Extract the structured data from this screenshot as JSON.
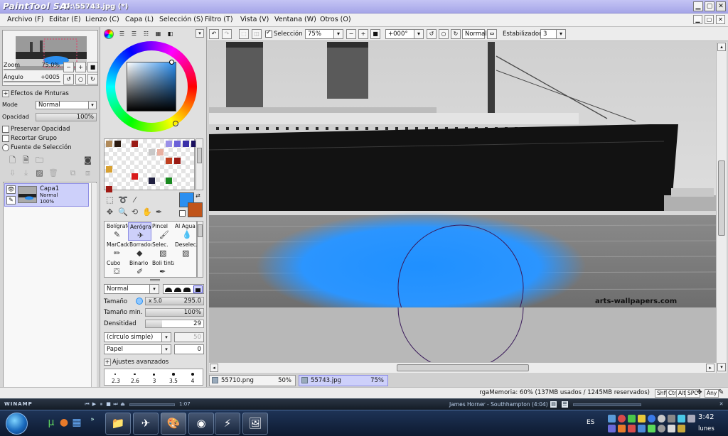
{
  "app": {
    "logo": "PaintTool SAI",
    "document_title": "D:\\55743.jpg (*)"
  },
  "menu": {
    "items": [
      "Archivo (F)",
      "Editar (E)",
      "Lienzo (C)",
      "Capa (L)",
      "Selección (S)",
      "Filtro (T)",
      "Vista (V)",
      "Ventana (W)",
      "Otros (O)"
    ]
  },
  "navigator": {
    "zoom_label": "Zoom",
    "zoom_value": "75.0%",
    "angle_label": "Ángulo",
    "angle_value": "+0005"
  },
  "layer_props": {
    "effects_label": "Efectos de Pinturas",
    "mode_label": "Mode",
    "mode_value": "Normal",
    "opacity_label": "Opacidad",
    "opacity_value": "100%",
    "opacity_fraction": 1.0,
    "preserve_opacity": "Preservar Opacidad",
    "clip_group": "Recortar Grupo",
    "selection_source": "Fuente de Selección"
  },
  "layers": [
    {
      "name": "Capa1",
      "mode": "Normal",
      "opacity": "100%"
    }
  ],
  "colors": {
    "primary": "#2b8ff0",
    "secondary": "#c0541a",
    "swatches": [
      "#b08a5a",
      "#2a1a10",
      "#9a1a14",
      "#9a90e8",
      "#6a60d8",
      "#3a30a8",
      "#1a1060",
      "#c8c8c8",
      "#e8b0a0",
      "#c04020",
      "#9a1a14",
      "#d8a030",
      "#d81a1a",
      "#202040",
      "#1a8a20",
      "#a01a14"
    ]
  },
  "tools": [
    {
      "label": "Bolígrafo",
      "icon": "pen-icon",
      "selected": false
    },
    {
      "label": "Aerógrafo",
      "icon": "airbrush-icon",
      "selected": true
    },
    {
      "label": "Pincel",
      "icon": "brush-icon",
      "selected": false
    },
    {
      "label": "Al Agua",
      "icon": "water-icon",
      "selected": false
    },
    {
      "label": "MarCado",
      "icon": "marker-icon",
      "selected": false
    },
    {
      "label": "Borrador",
      "icon": "eraser-icon",
      "selected": false
    },
    {
      "label": "Selec.",
      "icon": "select-icon",
      "selected": false
    },
    {
      "label": "Deselec.",
      "icon": "deselect-icon",
      "selected": false
    },
    {
      "label": "Cubo",
      "icon": "bucket-icon",
      "selected": false
    },
    {
      "label": "Binario",
      "icon": "binary-pen-icon",
      "selected": false
    },
    {
      "label": "Boli tinta",
      "icon": "ink-pen-icon",
      "selected": false
    }
  ],
  "brush": {
    "blend_mode": "Normal",
    "size_label": "Tamaño",
    "size_multiplier": "x 5.0",
    "size_value": "295.0",
    "min_size_label": "Tamaño min.",
    "min_size_value": "100%",
    "min_size_fraction": 1.0,
    "density_label": "Densitidad",
    "density_value": "29",
    "density_fraction": 0.29,
    "shape": "(círculo simple)",
    "shape_value": "50",
    "texture": "Papel",
    "texture_value": "0",
    "advanced_label": "Ajustes avanzados",
    "presets": [
      "2.3",
      "2.6",
      "3",
      "3.5",
      "4"
    ]
  },
  "canvas_toolbar": {
    "selection_label": "Selección",
    "zoom_value": "75%",
    "angle_value": "+000°",
    "mode_value": "Normal",
    "stabilizer_label": "Estabilizador",
    "stabilizer_value": "3"
  },
  "canvas": {
    "watermark": "arts-wallpapers.com"
  },
  "scroll": {
    "vertical_fraction": 0.46,
    "horizontal_fraction": 0.5
  },
  "doc_tabs": [
    {
      "name": "55710.png",
      "zoom": "50%",
      "active": false
    },
    {
      "name": "55743.jpg",
      "zoom": "75%",
      "active": true
    }
  ],
  "status": {
    "memory_text": "rgaMemoria: 60% (137MB usados / 1245MB reservados)",
    "keys": [
      "Shft",
      "Ctrl",
      "Alt",
      "SPC",
      "Any"
    ]
  },
  "winamp": {
    "label": "WINAMP",
    "time": "1:07",
    "track": "James Horner - Southhampton (4:04)"
  },
  "taskbar": {
    "language": "ES",
    "time": "3:42",
    "day": "lunes"
  }
}
